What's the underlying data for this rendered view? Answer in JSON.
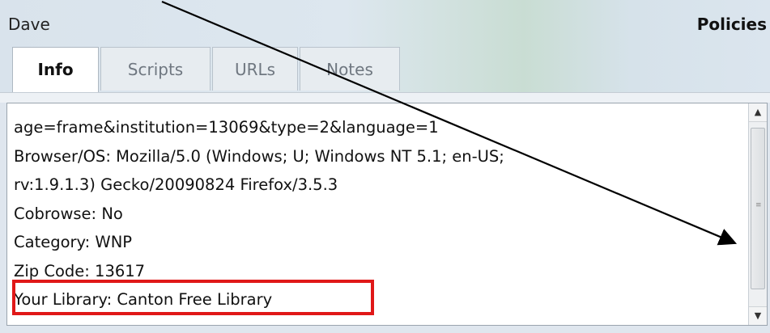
{
  "header": {
    "chat_user": "Dave",
    "policies_label": "Policies"
  },
  "tabs": [
    {
      "label": "Info",
      "active": true
    },
    {
      "label": "Scripts",
      "active": false
    },
    {
      "label": "URLs",
      "active": false
    },
    {
      "label": "Notes",
      "active": false
    }
  ],
  "info_panel": {
    "lines": [
      "age=frame&institution=13069&type=2&language=1",
      "Browser/OS: Mozilla/5.0 (Windows; U; Windows NT 5.1; en-US;",
      "rv:1.9.1.3) Gecko/20090824 Firefox/3.5.3",
      "Cobrowse: No",
      "Category: WNP",
      "Zip Code: 13617",
      "Your Library: Canton Free Library"
    ]
  },
  "annotation": {
    "highlight_color": "#e01818",
    "arrow_color": "#000000"
  }
}
